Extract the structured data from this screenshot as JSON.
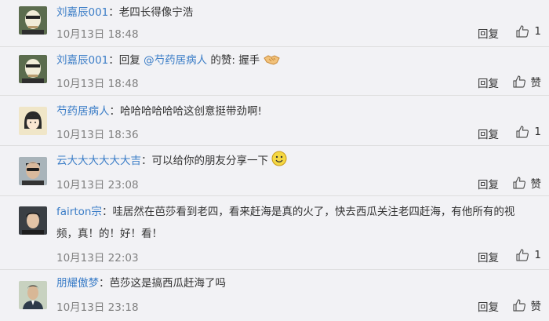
{
  "comments": [
    {
      "author": "刘嘉辰001",
      "sep": "：",
      "text": "老四长得像宁浩",
      "date": "10月13日 18:48",
      "reply_label": "回复",
      "like_label": "1",
      "avatar_icon": "avatar-masked-man"
    },
    {
      "author": "刘嘉辰001",
      "sep": "：",
      "reply_prefix": "回复 ",
      "mention": "@芍药居病人",
      "text": " 的赞: 握手",
      "date": "10月13日 18:48",
      "reply_label": "回复",
      "like_label": "赞",
      "avatar_icon": "avatar-masked-man"
    },
    {
      "author": "芍药居病人",
      "sep": "：",
      "text": "哈哈哈哈哈哈这创意挺带劲啊!",
      "date": "10月13日 18:36",
      "reply_label": "回复",
      "like_label": "1",
      "avatar_icon": "avatar-cartoon-girl"
    },
    {
      "author": "云大大大大大大吉",
      "sep": "：",
      "text": "可以给你的朋友分享一下",
      "date": "10月13日 23:08",
      "reply_label": "回复",
      "like_label": "赞",
      "avatar_icon": "avatar-sunglasses-man"
    },
    {
      "author": "fairton宗",
      "sep": "：",
      "text": "哇居然在芭莎看到老四，看来赶海是真的火了，快去西瓜关注老四赶海，有他所有的视",
      "text_line2": "频，真！的！好！看！",
      "date": "10月13日 22:03",
      "reply_label": "回复",
      "like_label": "1",
      "avatar_icon": "avatar-dark-hair-man"
    },
    {
      "author": "朋耀傲梦",
      "sep": "：",
      "text": "芭莎这是搞西瓜赶海了吗",
      "date": "10月13日 23:18",
      "reply_label": "回复",
      "like_label": "赞",
      "avatar_icon": "avatar-suit-man"
    }
  ]
}
